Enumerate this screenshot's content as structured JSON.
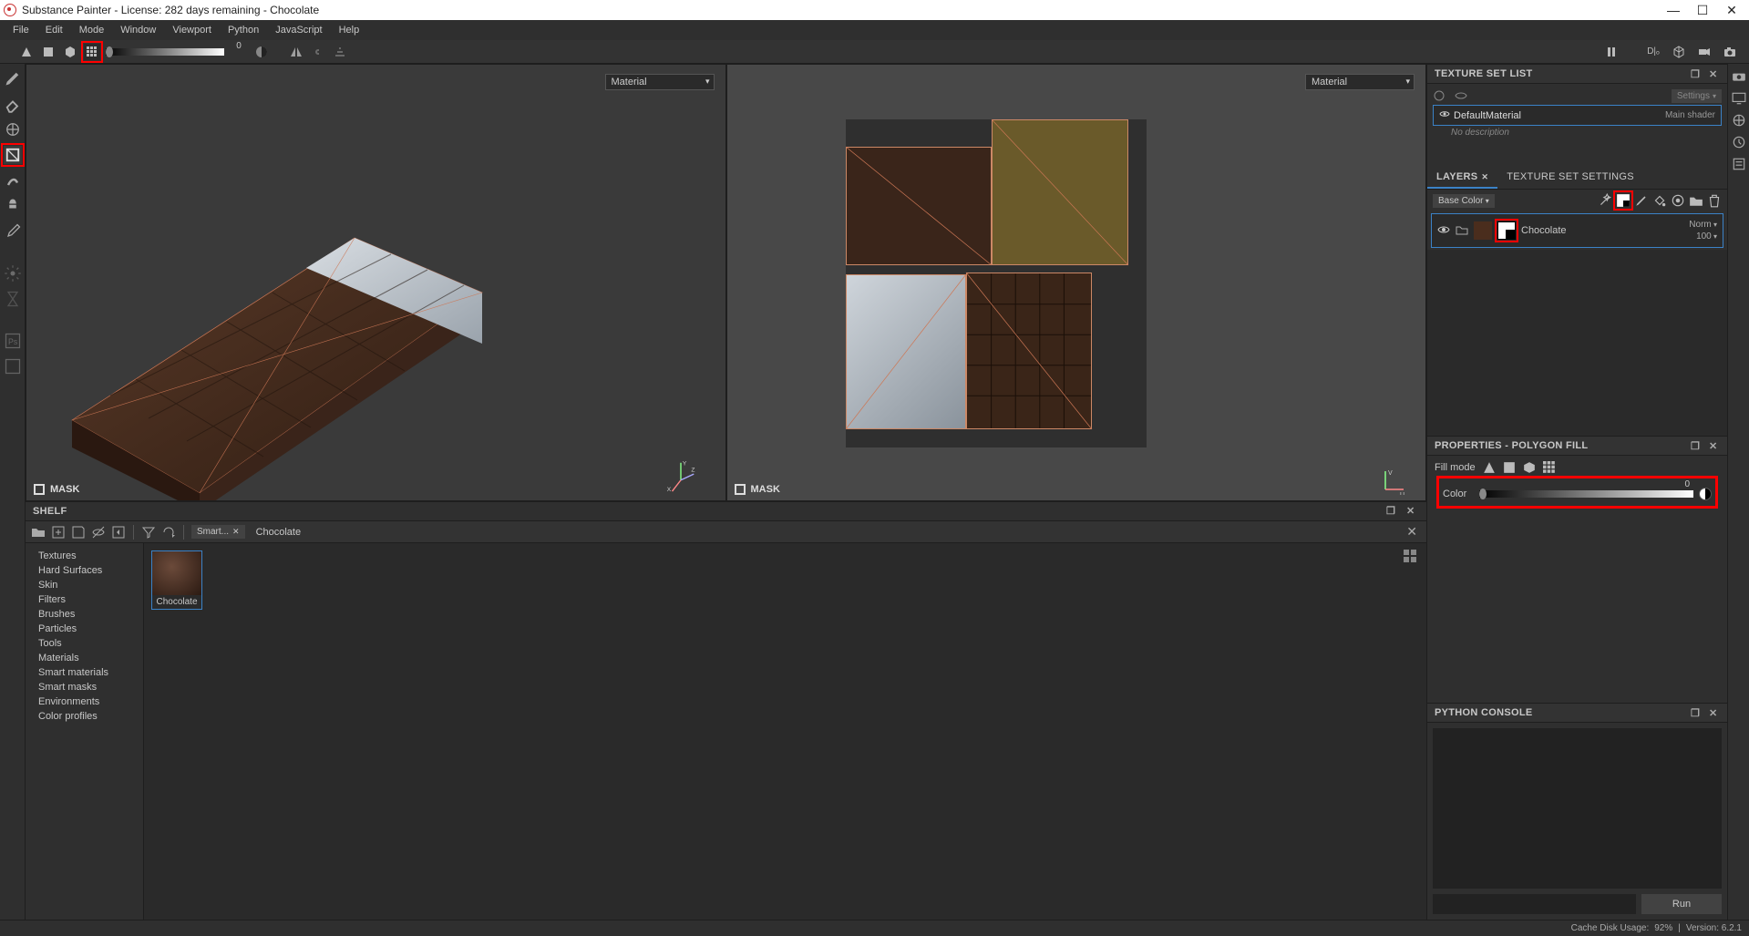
{
  "titlebar": {
    "title": "Substance Painter - License: 282 days remaining - Chocolate"
  },
  "menubar": {
    "items": [
      "File",
      "Edit",
      "Mode",
      "Window",
      "Viewport",
      "Python",
      "JavaScript",
      "Help"
    ]
  },
  "toolbar": {
    "slider_value": "0"
  },
  "viewports": {
    "left_mode": "Material",
    "right_mode": "Material",
    "mask_label": "MASK"
  },
  "shelf": {
    "title": "SHELF",
    "tab": "Smart...",
    "crumb": "Chocolate",
    "categories": [
      "Textures",
      "Hard Surfaces",
      "Skin",
      "Filters",
      "Brushes",
      "Particles",
      "Tools",
      "Materials",
      "Smart materials",
      "Smart masks",
      "Environments",
      "Color profiles"
    ],
    "asset_label": "Chocolate"
  },
  "right": {
    "texset": {
      "title": "TEXTURE SET LIST",
      "settings_label": "Settings",
      "item_name": "DefaultMaterial",
      "shader": "Main shader",
      "desc": "No description"
    },
    "layers": {
      "tab_layers": "LAYERS",
      "tab_settings": "TEXTURE SET SETTINGS",
      "channel": "Base Color",
      "layer_name": "Chocolate",
      "blend": "Norm",
      "opacity": "100"
    },
    "props": {
      "title": "PROPERTIES - POLYGON FILL",
      "fillmode_label": "Fill mode",
      "color_label": "Color",
      "color_value": "0"
    },
    "python": {
      "title": "PYTHON CONSOLE",
      "run_label": "Run"
    }
  },
  "statusbar": {
    "cache": "Cache Disk Usage:",
    "pct": "92%",
    "version": "Version: 6.2.1"
  }
}
